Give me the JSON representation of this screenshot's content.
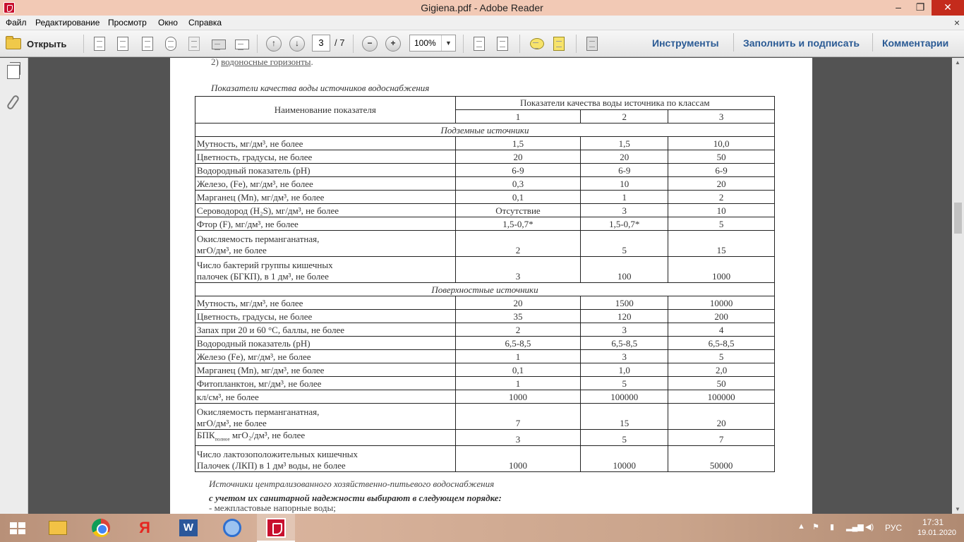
{
  "window": {
    "title": "Gigiena.pdf - Adobe Reader",
    "minimize": "–",
    "restore": "❐",
    "close": "✕"
  },
  "menu": [
    "Файл",
    "Редактирование",
    "Просмотр",
    "Окно",
    "Справка"
  ],
  "menu_close": "×",
  "toolbar": {
    "open_label": "Открыть",
    "page_current": "3",
    "page_total": "/ 7",
    "zoom": "100%",
    "zoom_dropdown": "▼",
    "up_arrow": "↑",
    "down_arrow": "↓",
    "zoom_out": "−",
    "zoom_in": "+",
    "tools": "Инструменты",
    "fill_sign": "Заполнить и подписать",
    "comments": "Комментарии"
  },
  "document": {
    "top_line_prefix": "2) ",
    "top_line_link": "водоносные горизонты",
    "top_line_suffix": ".",
    "table_caption": "Показатели качества воды источников водоснабжения",
    "header": {
      "name_col": "Наименование показателя",
      "group": "Показатели качества воды источника по классам",
      "classes": [
        "1",
        "2",
        "3"
      ]
    },
    "sections": [
      {
        "title": "Подземные источники",
        "rows": [
          {
            "name": "Мутность, мг/дм³, не более",
            "v": [
              "1,5",
              "1,5",
              "10,0"
            ]
          },
          {
            "name": "Цветность, градусы, не более",
            "v": [
              "20",
              "20",
              "50"
            ]
          },
          {
            "name": "Водородный показатель (pH)",
            "v": [
              "6-9",
              "6-9",
              "6-9"
            ]
          },
          {
            "name": "Железо, (Fe), мг/дм³, не более",
            "v": [
              "0,3",
              "10",
              "20"
            ]
          },
          {
            "name": "Марганец (Mn), мг/дм³, не более",
            "v": [
              "0,1",
              "1",
              "2"
            ]
          },
          {
            "name": "Сероводород (H₂S), мг/дм³, не более",
            "v": [
              "Отсутствие",
              "3",
              "10"
            ]
          },
          {
            "name": "Фтор (F), мг/дм³, не более",
            "v": [
              "1,5-0,7*",
              "1,5-0,7*",
              "5"
            ]
          },
          {
            "name_l1": "Окисляемость перманганатная,",
            "name_l2": "мгО/дм³, не более",
            "v": [
              "2",
              "5",
              "15"
            ]
          },
          {
            "name_l1": "Число бактерий группы кишечных",
            "name_l2": "палочек (БГКП), в 1 дм³, не более",
            "v": [
              "3",
              "100",
              "1000"
            ]
          }
        ]
      },
      {
        "title": "Поверхностные источники",
        "rows": [
          {
            "name": "Мутность, мг/дм³, не более",
            "v": [
              "20",
              "1500",
              "10000"
            ]
          },
          {
            "name": "Цветность, градусы, не более",
            "v": [
              "35",
              "120",
              "200"
            ]
          },
          {
            "name": "Запах при 20 и 60 °С, баллы, не более",
            "v": [
              "2",
              "3",
              "4"
            ]
          },
          {
            "name": "Водородный показатель (pH)",
            "v": [
              "6,5-8,5",
              "6,5-8,5",
              "6,5-8,5"
            ]
          },
          {
            "name": "Железо (Fe), мг/дм³, не более",
            "v": [
              "1",
              "3",
              "5"
            ]
          },
          {
            "name": "Марганец (Mn), мг/дм³, не более",
            "v": [
              "0,1",
              "1,0",
              "2,0"
            ]
          },
          {
            "name": "Фитопланктон, мг/дм³, не более",
            "v": [
              "1",
              "5",
              "50"
            ]
          },
          {
            "name": "кл/см³, не более",
            "v": [
              "1000",
              "100000",
              "100000"
            ]
          },
          {
            "name_l1": "Окисляемость перманганатная,",
            "name_l2": "мгО/дм³, не более",
            "v": [
              "7",
              "15",
              "20"
            ]
          },
          {
            "name_a": "БПК",
            "name_sub": "полное",
            "name_b": " мгО₂/дм³, не более",
            "v": [
              "3",
              "5",
              "7"
            ]
          },
          {
            "name_l1": "Число лактозоположительных кишечных",
            "name_l2": "Палочек (ЛКП) в 1 дм³ воды, не более",
            "v": [
              "1000",
              "10000",
              "50000"
            ]
          }
        ]
      }
    ],
    "footer_line1": "Источники централизованного хозяйственно-питьевого водоснабжения",
    "footer_line2": "с учетом их санитарной надежности выбирают в следующем порядке:",
    "footer_line3": "- межпластовые напорные воды;"
  },
  "taskbar": {
    "lang": "РУС",
    "time": "17:31",
    "date": "19.01.2020",
    "yandex": "Я",
    "word": "W"
  },
  "colors": {
    "accent_link": "#2a5a94",
    "reader_red": "#c8102e"
  }
}
